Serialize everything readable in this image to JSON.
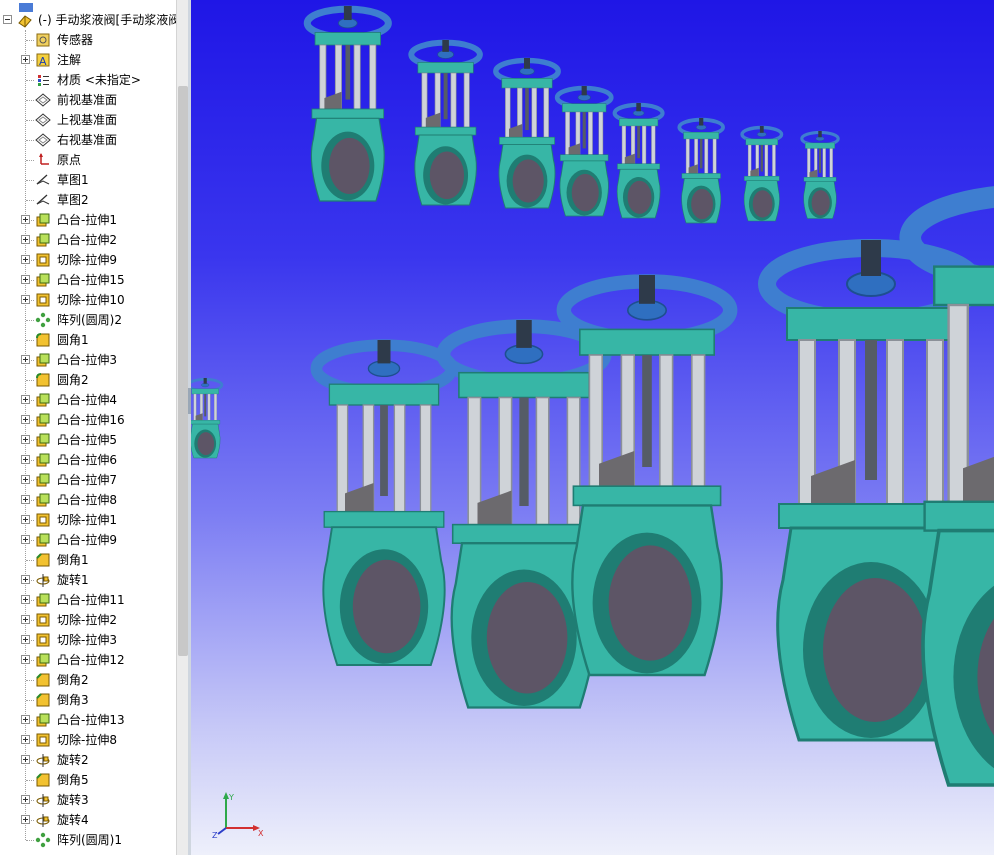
{
  "tree": {
    "top_partial": "",
    "root_label": "(-) 手动浆液阀[手动浆液阀",
    "items": [
      {
        "label": "传感器",
        "icon": "sensor-icon",
        "exp": false
      },
      {
        "label": "注解",
        "icon": "annotation-icon",
        "exp": true
      },
      {
        "label": "材质 <未指定>",
        "icon": "material-icon",
        "exp": false
      },
      {
        "label": "前视基准面",
        "icon": "plane-icon",
        "exp": false
      },
      {
        "label": "上视基准面",
        "icon": "plane-icon",
        "exp": false
      },
      {
        "label": "右视基准面",
        "icon": "plane-icon",
        "exp": false
      },
      {
        "label": "原点",
        "icon": "origin-icon",
        "exp": false
      },
      {
        "label": "草图1",
        "icon": "sketch-icon",
        "exp": false
      },
      {
        "label": "草图2",
        "icon": "sketch-icon",
        "exp": false
      },
      {
        "label": "凸台-拉伸1",
        "icon": "boss-extrude-icon",
        "exp": true
      },
      {
        "label": "凸台-拉伸2",
        "icon": "boss-extrude-icon",
        "exp": true
      },
      {
        "label": "切除-拉伸9",
        "icon": "cut-extrude-icon",
        "exp": true
      },
      {
        "label": "凸台-拉伸15",
        "icon": "boss-extrude-icon",
        "exp": true
      },
      {
        "label": "切除-拉伸10",
        "icon": "cut-extrude-icon",
        "exp": true
      },
      {
        "label": "阵列(圆周)2",
        "icon": "circular-pattern-icon",
        "exp": false
      },
      {
        "label": "圆角1",
        "icon": "fillet-icon",
        "exp": false
      },
      {
        "label": "凸台-拉伸3",
        "icon": "boss-extrude-icon",
        "exp": true
      },
      {
        "label": "圆角2",
        "icon": "fillet-icon",
        "exp": false
      },
      {
        "label": "凸台-拉伸4",
        "icon": "boss-extrude-icon",
        "exp": true
      },
      {
        "label": "凸台-拉伸16",
        "icon": "boss-extrude-icon",
        "exp": true
      },
      {
        "label": "凸台-拉伸5",
        "icon": "boss-extrude-icon",
        "exp": true
      },
      {
        "label": "凸台-拉伸6",
        "icon": "boss-extrude-icon",
        "exp": true
      },
      {
        "label": "凸台-拉伸7",
        "icon": "boss-extrude-icon",
        "exp": true
      },
      {
        "label": "凸台-拉伸8",
        "icon": "boss-extrude-icon",
        "exp": true
      },
      {
        "label": "切除-拉伸1",
        "icon": "cut-extrude-icon",
        "exp": true
      },
      {
        "label": "凸台-拉伸9",
        "icon": "boss-extrude-icon",
        "exp": true
      },
      {
        "label": "倒角1",
        "icon": "chamfer-icon",
        "exp": false
      },
      {
        "label": "旋转1",
        "icon": "revolve-icon",
        "exp": true
      },
      {
        "label": "凸台-拉伸11",
        "icon": "boss-extrude-icon",
        "exp": true
      },
      {
        "label": "切除-拉伸2",
        "icon": "cut-extrude-icon",
        "exp": true
      },
      {
        "label": "切除-拉伸3",
        "icon": "cut-extrude-icon",
        "exp": true
      },
      {
        "label": "凸台-拉伸12",
        "icon": "boss-extrude-icon",
        "exp": true
      },
      {
        "label": "倒角2",
        "icon": "chamfer-icon",
        "exp": false
      },
      {
        "label": "倒角3",
        "icon": "chamfer-icon",
        "exp": false
      },
      {
        "label": "凸台-拉伸13",
        "icon": "boss-extrude-icon",
        "exp": true
      },
      {
        "label": "切除-拉伸8",
        "icon": "cut-extrude-icon",
        "exp": true
      },
      {
        "label": "旋转2",
        "icon": "revolve-icon",
        "exp": true
      },
      {
        "label": "倒角5",
        "icon": "chamfer-icon",
        "exp": false
      },
      {
        "label": "旋转3",
        "icon": "revolve-icon",
        "exp": true
      },
      {
        "label": "旋转4",
        "icon": "revolve-icon",
        "exp": true
      },
      {
        "label": "阵列(圆周)1",
        "icon": "circular-pattern-icon",
        "exp": false
      }
    ]
  },
  "triad": {
    "x": "X",
    "y": "Y",
    "z": "Z"
  },
  "colors": {
    "body": "#37b6a6",
    "body_dark": "#1f7d73",
    "wheel": "#3e7ed0",
    "disc": "#5d5566",
    "rod": "#cfd3d8",
    "gate": "#6c6a6e"
  },
  "valves": [
    {
      "size": 1.0
    },
    {
      "size": 0.78
    },
    {
      "size": 0.66
    },
    {
      "size": 0.6
    },
    {
      "size": 0.52
    },
    {
      "size": 0.46
    },
    {
      "size": 0.42
    },
    {
      "size": 0.38
    },
    {
      "size": 0.35
    },
    {
      "size": 0.32
    },
    {
      "size": 1.3
    },
    {
      "size": 1.55
    },
    {
      "size": 1.6
    },
    {
      "size": 2.0
    },
    {
      "size": 2.4
    }
  ]
}
